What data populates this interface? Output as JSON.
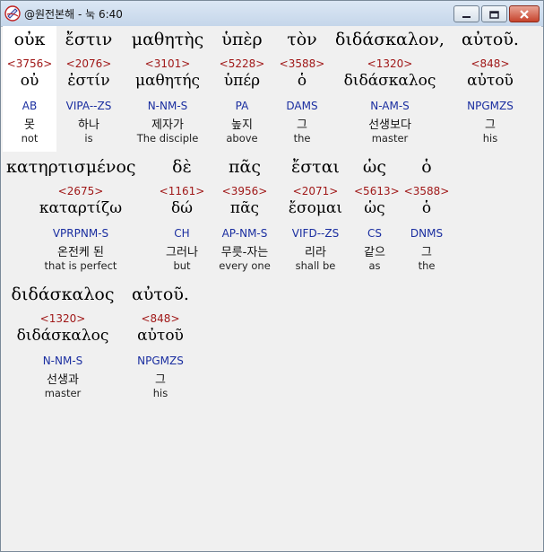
{
  "window": {
    "title": "@원전본해 - 눅 6:40",
    "icon": "app-book-icon"
  },
  "controls": {
    "minimize_icon": "minimize-icon",
    "maximize_icon": "maximize-icon",
    "close_icon": "close-icon"
  },
  "colors": {
    "strongs": "#a01818",
    "parsing": "#1a2ea0",
    "titlebar": "#c5d6ea",
    "close": "#c6432c"
  },
  "words": [
    {
      "greek": "οὐκ",
      "strongs": "<3756>",
      "lemma": "οὐ",
      "parsing": "AB",
      "korean": "못",
      "english": "not"
    },
    {
      "greek": "ἔστιν",
      "strongs": "<2076>",
      "lemma": "ἐστίν",
      "parsing": "VIPA--ZS",
      "korean": "하나",
      "english": "is"
    },
    {
      "greek": "μαθητὴς",
      "strongs": "<3101>",
      "lemma": "μαθητής",
      "parsing": "N-NM-S",
      "korean": "제자가",
      "english": "The disciple"
    },
    {
      "greek": "ὑπὲρ",
      "strongs": "<5228>",
      "lemma": "ὑπέρ",
      "parsing": "PA",
      "korean": "높지",
      "english": "above"
    },
    {
      "greek": "τὸν",
      "strongs": "<3588>",
      "lemma": "ὁ",
      "parsing": "DAMS",
      "korean": "그",
      "english": "the"
    },
    {
      "greek": "διδάσκαλον,",
      "strongs": "<1320>",
      "lemma": "διδάσκαλος",
      "parsing": "N-AM-S",
      "korean": "선생보다",
      "english": "master"
    },
    {
      "greek": "αὐτοῦ.",
      "strongs": "<848>",
      "lemma": "αὐτοῦ",
      "parsing": "NPGMZS",
      "korean": "그",
      "english": "his"
    },
    {
      "greek": "κατηρτισμένος",
      "strongs": "<2675>",
      "lemma": "καταρτίζω",
      "parsing": "VPRPNM-S",
      "korean": "온전케 된",
      "english": "that is perfect"
    },
    {
      "greek": "δὲ",
      "strongs": "<1161>",
      "lemma": "δώ",
      "parsing": "CH",
      "korean": "그러나",
      "english": "but"
    },
    {
      "greek": "πᾶς",
      "strongs": "<3956>",
      "lemma": "πᾶς",
      "parsing": "AP-NM-S",
      "korean": "무릇-자는",
      "english": "every one"
    },
    {
      "greek": "ἔσται",
      "strongs": "<2071>",
      "lemma": "ἔσομαι",
      "parsing": "VIFD--ZS",
      "korean": "리라",
      "english": "shall be"
    },
    {
      "greek": "ὡς",
      "strongs": "<5613>",
      "lemma": "ὡς",
      "parsing": "CS",
      "korean": "같으",
      "english": "as"
    },
    {
      "greek": "ὁ",
      "strongs": "<3588>",
      "lemma": "ὁ",
      "parsing": "DNMS",
      "korean": "그",
      "english": "the"
    },
    {
      "greek": "διδάσκαλος",
      "strongs": "<1320>",
      "lemma": "διδάσκαλος",
      "parsing": "N-NM-S",
      "korean": "선생과",
      "english": "master"
    },
    {
      "greek": "αὐτοῦ.",
      "strongs": "<848>",
      "lemma": "αὐτοῦ",
      "parsing": "NPGMZS",
      "korean": "그",
      "english": "his"
    }
  ]
}
